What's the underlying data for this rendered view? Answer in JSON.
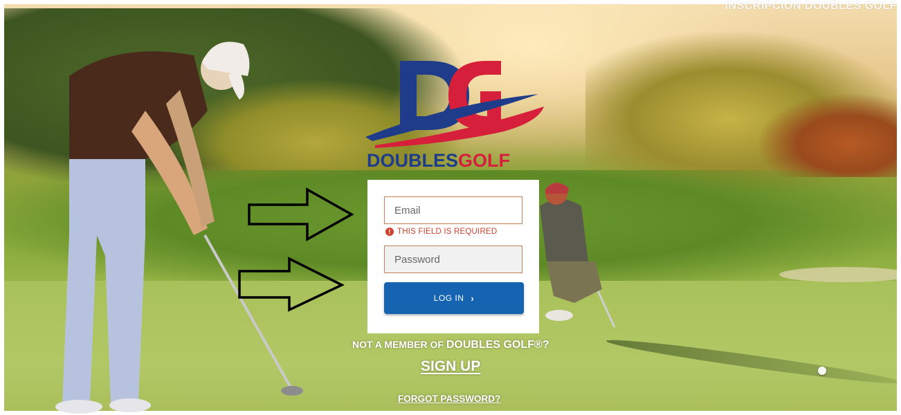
{
  "header": {
    "top_link": "INSCRIPCION DOUBLES GOLF"
  },
  "logo": {
    "monogram": "DG",
    "word1": "DOUBLES",
    "word2": "GOLF",
    "colors": {
      "navy": "#1f3c8a",
      "red": "#d61f3a"
    }
  },
  "login_form": {
    "email_placeholder": "Email",
    "email_value": "",
    "error_text": "THIS FIELD IS REQUIRED",
    "password_placeholder": "Password",
    "password_value": "",
    "login_label": "LOG IN",
    "login_icon": "chevron-right-icon",
    "button_color": "#1663b2",
    "error_color": "#d0422f"
  },
  "footer": {
    "not_member_prefix": "NOT A MEMBER OF",
    "not_member_brand": "DOUBLES GOLF®?",
    "signup_label": "SIGN UP",
    "forgot_label": "FORGOT PASSWORD?"
  },
  "annotations": {
    "arrow_icon": "right-arrow-icon",
    "arrow_count": 2
  }
}
